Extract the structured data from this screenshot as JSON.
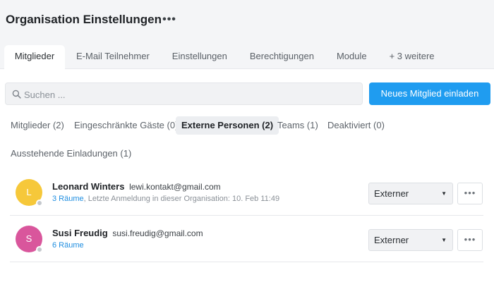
{
  "header": {
    "title": "Organisation Einstellungen",
    "more_label": "•••"
  },
  "tabs": [
    {
      "label": "Mitglieder",
      "active": true
    },
    {
      "label": "E-Mail Teilnehmer",
      "active": false
    },
    {
      "label": "Einstellungen",
      "active": false
    },
    {
      "label": "Berechtigungen",
      "active": false
    },
    {
      "label": "Module",
      "active": false
    },
    {
      "label": "+ 3 weitere",
      "active": false
    }
  ],
  "search": {
    "placeholder": "Suchen ...",
    "value": "",
    "icon": "search-icon"
  },
  "invite_button": {
    "label": "Neues Mitglied einladen",
    "color": "#1f9cf0"
  },
  "filters": [
    {
      "label": "Mitglieder (2)",
      "active": false
    },
    {
      "label": "Eingeschränkte Gäste (0)",
      "active": false
    },
    {
      "label": "Externe Personen (2)",
      "active": true
    },
    {
      "label": "Teams (1)",
      "active": false
    },
    {
      "label": "Deaktiviert (0)",
      "active": false
    },
    {
      "label": "Ausstehende Einladungen (1)",
      "active": false
    }
  ],
  "members": [
    {
      "initial": "L",
      "avatar_color": "#f6c83a",
      "name": "Leonard Winters",
      "email": "lewi.kontakt@gmail.com",
      "rooms": "3 Räume",
      "last_login": ", Letzte Anmeldung in dieser Organisation: 10. Feb 11:49",
      "role": "Externer",
      "more_label": "•••"
    },
    {
      "initial": "S",
      "avatar_color": "#d9569c",
      "name": "Susi Freudig",
      "email": "susi.freudig@gmail.com",
      "rooms": "6 Räume",
      "last_login": "",
      "role": "Externer",
      "more_label": "•••"
    }
  ],
  "caret_glyph": "▼"
}
